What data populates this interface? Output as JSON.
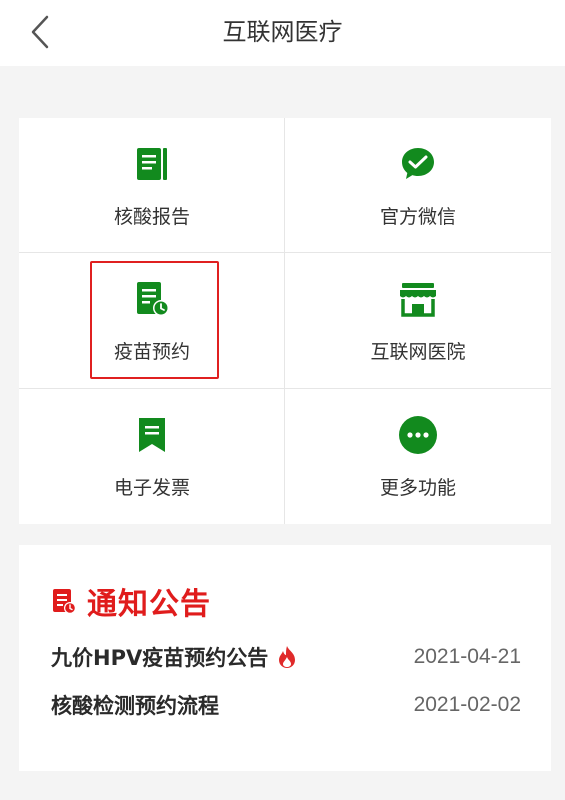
{
  "header": {
    "title": "互联网医疗"
  },
  "grid": {
    "items": [
      {
        "label": "核酸报告",
        "icon": "report-icon"
      },
      {
        "label": "官方微信",
        "icon": "wechat-icon"
      },
      {
        "label": "疫苗预约",
        "icon": "vaccine-appointment-icon"
      },
      {
        "label": "互联网医院",
        "icon": "store-icon"
      },
      {
        "label": "电子发票",
        "icon": "bookmark-icon"
      },
      {
        "label": "更多功能",
        "icon": "more-icon"
      }
    ]
  },
  "notice": {
    "title": "通知公告",
    "items": [
      {
        "title": "九价HPV疫苗预约公告",
        "date": "2021-04-21",
        "hot": true
      },
      {
        "title": "核酸检测预约流程",
        "date": "2021-02-02",
        "hot": false
      }
    ]
  },
  "colors": {
    "accent": "#128a1e",
    "alert": "#e01c1c"
  }
}
